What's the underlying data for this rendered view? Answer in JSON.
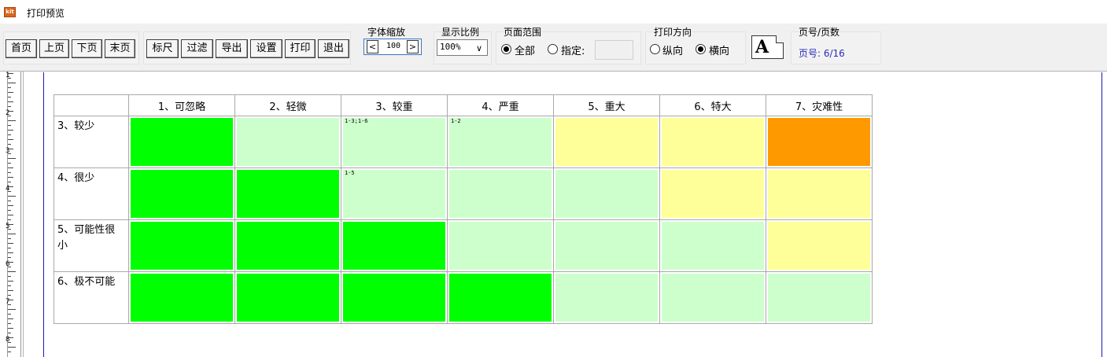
{
  "window": {
    "title": "打印预览",
    "icon_name": "app-kit-icon"
  },
  "toolbar": {
    "nav_buttons": [
      "首页",
      "上页",
      "下页",
      "末页"
    ],
    "action_buttons": [
      "标尺",
      "过滤",
      "导出",
      "设置",
      "打印",
      "退出"
    ],
    "font_zoom": {
      "label": "字体缩放",
      "dec": "<",
      "value": "100",
      "inc": ">"
    },
    "display_scale": {
      "label": "显示比例",
      "value": "100%"
    },
    "page_range": {
      "label": "页面范围",
      "all": "全部",
      "specify": "指定:",
      "selected": "all"
    },
    "orientation": {
      "label": "打印方向",
      "portrait": "纵向",
      "landscape": "横向",
      "selected": "landscape"
    },
    "font_icon_glyph": "A",
    "page_info": {
      "label": "页号/页数",
      "text": "页号: 6/16"
    }
  },
  "ruler": {
    "marks": [
      "1",
      "2",
      "3",
      "4",
      "5",
      "6",
      "7",
      "8"
    ]
  },
  "matrix": {
    "columns": [
      "",
      "1、可忽略",
      "2、轻微",
      "3、较重",
      "4、严重",
      "5、重大",
      "6、特大",
      "7、灾难性"
    ],
    "colors": {
      "green": "#00ff00",
      "light_green": "#ccffcc",
      "yellow": "#ffff99",
      "orange": "#ff9900"
    },
    "rows": [
      {
        "label": "3、较少",
        "cells": [
          {
            "color": "green",
            "code": ""
          },
          {
            "color": "light_green",
            "code": ""
          },
          {
            "color": "light_green",
            "code": "1-3;1-6"
          },
          {
            "color": "light_green",
            "code": "1-2"
          },
          {
            "color": "yellow",
            "code": ""
          },
          {
            "color": "yellow",
            "code": ""
          },
          {
            "color": "orange",
            "code": ""
          }
        ]
      },
      {
        "label": "4、很少",
        "cells": [
          {
            "color": "green",
            "code": ""
          },
          {
            "color": "green",
            "code": ""
          },
          {
            "color": "light_green",
            "code": "1-5"
          },
          {
            "color": "light_green",
            "code": ""
          },
          {
            "color": "light_green",
            "code": ""
          },
          {
            "color": "yellow",
            "code": ""
          },
          {
            "color": "yellow",
            "code": ""
          }
        ]
      },
      {
        "label": "5、可能性很小",
        "cells": [
          {
            "color": "green",
            "code": ""
          },
          {
            "color": "green",
            "code": ""
          },
          {
            "color": "green",
            "code": ""
          },
          {
            "color": "light_green",
            "code": ""
          },
          {
            "color": "light_green",
            "code": ""
          },
          {
            "color": "light_green",
            "code": ""
          },
          {
            "color": "yellow",
            "code": ""
          }
        ]
      },
      {
        "label": "6、极不可能",
        "cells": [
          {
            "color": "green",
            "code": ""
          },
          {
            "color": "green",
            "code": ""
          },
          {
            "color": "green",
            "code": ""
          },
          {
            "color": "green",
            "code": ""
          },
          {
            "color": "light_green",
            "code": ""
          },
          {
            "color": "light_green",
            "code": ""
          },
          {
            "color": "light_green",
            "code": ""
          }
        ]
      }
    ]
  }
}
